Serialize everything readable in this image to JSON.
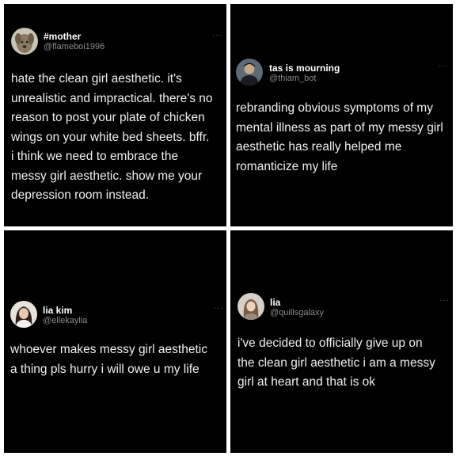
{
  "posts": [
    {
      "name": "#mother",
      "handle": "@flameboi1996",
      "more": "···",
      "avatar_icon": "dog-avatar-icon",
      "lines": [
        "hate the clean girl aesthetic. it's",
        "unrealistic and impractical. there's no",
        "reason to post your plate of chicken",
        "wings on your white bed sheets. bffr.",
        "i think we need to embrace the",
        "messy girl aesthetic. show me your",
        "depression room instead."
      ]
    },
    {
      "name": "tas is mourning",
      "handle": "@thiam_bot",
      "more": "···",
      "avatar_icon": "person-avatar-icon",
      "lines": [
        "rebranding obvious symptoms of my",
        "mental illness as part of my messy girl",
        "aesthetic has really helped me",
        "romanticize my life"
      ]
    },
    {
      "name": "lia kim",
      "handle": "@ellekaylia",
      "more": "···",
      "avatar_icon": "woman-avatar-icon",
      "lines": [
        "whoever makes messy girl aesthetic",
        "a thing pls hurry i will owe u my life"
      ]
    },
    {
      "name": "lia",
      "handle": "@quillsgalaxy",
      "more": "···",
      "avatar_icon": "portrait-avatar-icon",
      "lines": [
        "i've decided to officially give up on",
        "the clean girl aesthetic i am a messy",
        "girl at heart and that is ok"
      ]
    }
  ],
  "colors": {
    "background": "#ffffff",
    "panel": "#000000",
    "text": "#f0f0f0",
    "handle": "#8b8b8b"
  }
}
